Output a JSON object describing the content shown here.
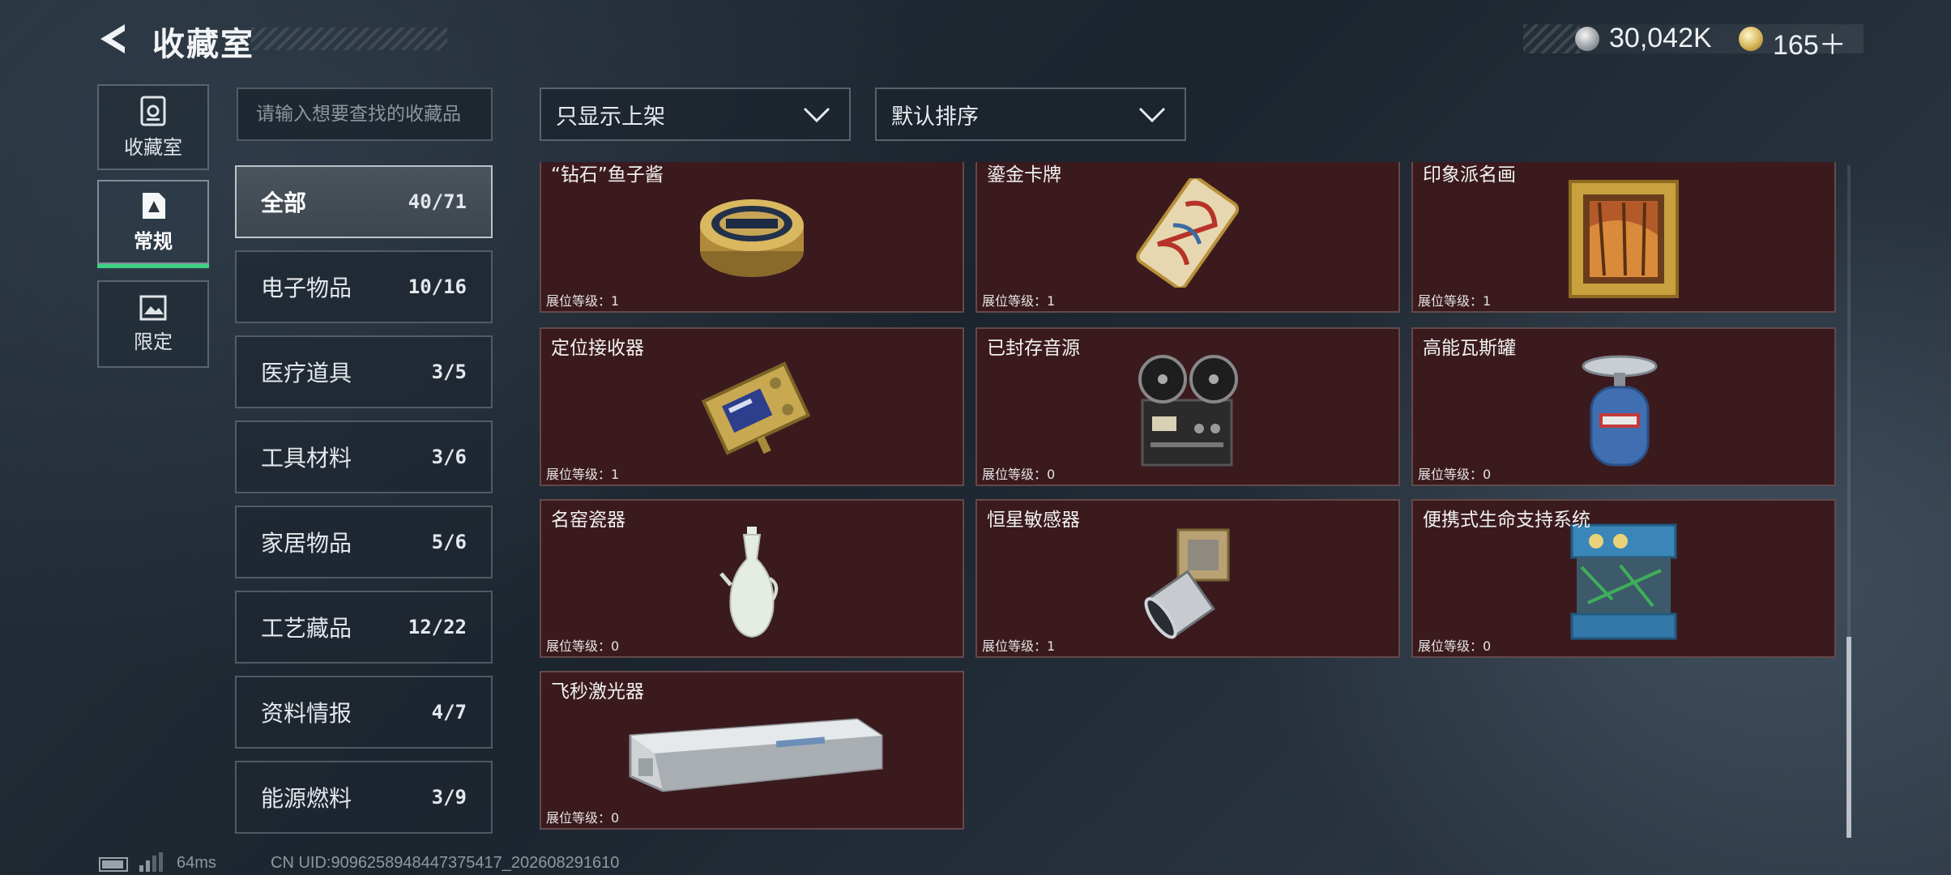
{
  "header": {
    "title": "收藏室",
    "currency_silver": "30,042K",
    "currency_gold": "165＋"
  },
  "left_nav": [
    {
      "label": "收藏室",
      "icon": "collection-box-icon",
      "active": false
    },
    {
      "label": "常规",
      "icon": "regular-card-icon",
      "active": true
    },
    {
      "label": "限定",
      "icon": "limited-picture-icon",
      "active": false
    }
  ],
  "search": {
    "placeholder": "请输入想要查找的收藏品"
  },
  "filters": {
    "shelf_filter": "只显示上架",
    "sort_order": "默认排序"
  },
  "categories": [
    {
      "label": "全部",
      "count": "40/71",
      "active": true
    },
    {
      "label": "电子物品",
      "count": "10/16"
    },
    {
      "label": "医疗道具",
      "count": "3/5"
    },
    {
      "label": "工具材料",
      "count": "3/6"
    },
    {
      "label": "家居物品",
      "count": "5/6"
    },
    {
      "label": "工艺藏品",
      "count": "12/22"
    },
    {
      "label": "资料情报",
      "count": "4/7"
    },
    {
      "label": "能源燃料",
      "count": "3/9"
    }
  ],
  "items": [
    {
      "name": "“钻石”鱼子酱",
      "level": "展位等级：1",
      "icon": "caviar-tin-icon"
    },
    {
      "name": "鎏金卡牌",
      "level": "展位等级：1",
      "icon": "gilded-card-icon"
    },
    {
      "name": "印象派名画",
      "level": "展位等级：1",
      "icon": "framed-painting-icon"
    },
    {
      "name": "定位接收器",
      "level": "展位等级：1",
      "icon": "locator-receiver-icon"
    },
    {
      "name": "已封存音源",
      "level": "展位等级：0",
      "icon": "reel-recorder-icon"
    },
    {
      "name": "高能瓦斯罐",
      "level": "展位等级：0",
      "icon": "gas-canister-icon"
    },
    {
      "name": "名窑瓷器",
      "level": "展位等级：0",
      "icon": "porcelain-vase-icon"
    },
    {
      "name": "恒星敏感器",
      "level": "展位等级：1",
      "icon": "star-sensor-icon"
    },
    {
      "name": "便携式生命支持系统",
      "level": "展位等级：0",
      "icon": "life-support-icon"
    },
    {
      "name": "飞秒激光器",
      "level": "展位等级：0",
      "icon": "femtosecond-laser-icon"
    }
  ],
  "footer": {
    "ping": "64ms",
    "uid": "CN UID:9096258948447375417_202608291610"
  }
}
